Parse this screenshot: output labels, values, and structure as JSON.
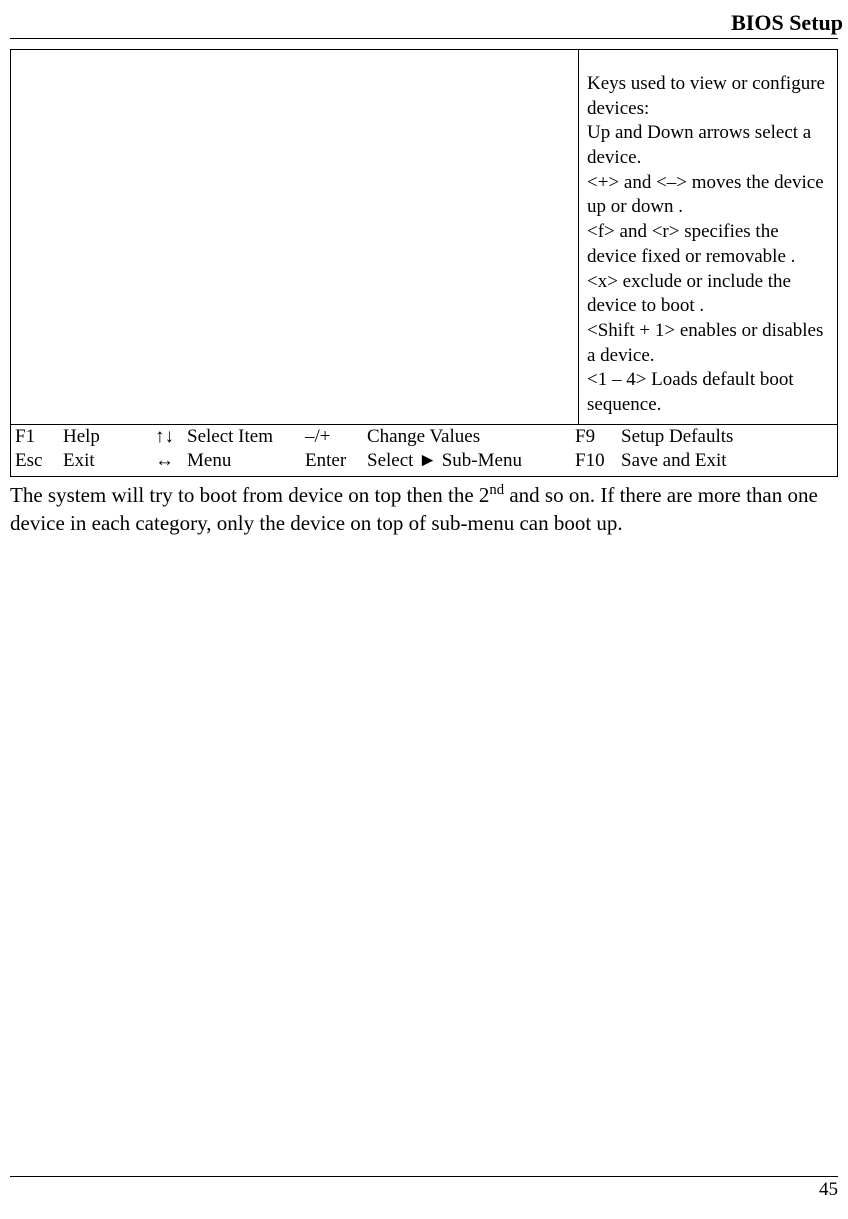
{
  "header": {
    "title": "BIOS Setup"
  },
  "help_panel": {
    "intro": "Keys used to view or configure devices:",
    "line_arrows": "Up and Down arrows select a device.",
    "line_plusminus": "<+> and <–> moves the device up or down .",
    "line_fr": "<f> and <r> specifies the device fixed or removable .",
    "line_x": "<x> exclude or include the device to boot .",
    "line_shift1": "<Shift + 1> enables or disables a device.",
    "line_14": "<1 – 4> Loads default boot sequence."
  },
  "key_footer": {
    "row1": {
      "k1": "F1",
      "a1": "Help",
      "k2": "↑↓",
      "a2": "Select Item",
      "k3": "–/+",
      "a3": "Change Values",
      "k4": "F9",
      "a4": "Setup Defaults"
    },
    "row2": {
      "k1": "Esc",
      "a1": "Exit",
      "k2": "↔",
      "a2": "Menu",
      "k3": "Enter",
      "a3": "Select ► Sub-Menu",
      "k4": "F10",
      "a4": "Save and Exit"
    }
  },
  "body": {
    "para_pre": "The system will try to boot from device on top then the 2",
    "para_sup": "nd",
    "para_post": " and so on. If there are more than one device in each category, only the device on top of sub-menu can boot up."
  },
  "page_number": "45"
}
